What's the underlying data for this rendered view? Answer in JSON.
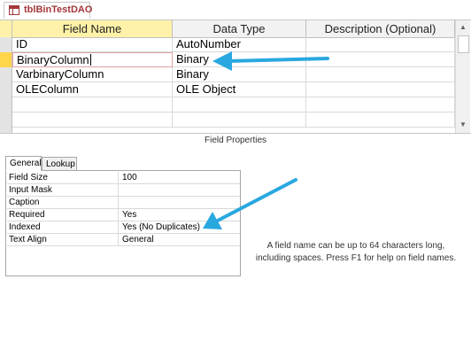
{
  "tab": {
    "title": "tblBinTestDAO",
    "icon": "table-icon"
  },
  "grid": {
    "columns": [
      "Field Name",
      "Data Type",
      "Description (Optional)"
    ],
    "rows": [
      {
        "name": "ID",
        "type": "AutoNumber",
        "description": ""
      },
      {
        "name": "BinaryColumn",
        "type": "Binary",
        "description": ""
      },
      {
        "name": "VarbinaryColumn",
        "type": "Binary",
        "description": ""
      },
      {
        "name": "OLEColumn",
        "type": "OLE Object",
        "description": ""
      }
    ],
    "selected_row": 1
  },
  "field_properties_label": "Field Properties",
  "property_tabs": [
    "General",
    "Lookup"
  ],
  "properties": [
    {
      "name": "Field Size",
      "value": "100"
    },
    {
      "name": "Input Mask",
      "value": ""
    },
    {
      "name": "Caption",
      "value": ""
    },
    {
      "name": "Required",
      "value": "Yes"
    },
    {
      "name": "Indexed",
      "value": "Yes (No Duplicates)"
    },
    {
      "name": "Text Align",
      "value": "General"
    }
  ],
  "help_text": "A field name can be up to 64 characters long, including spaces. Press F1 for help on field names.",
  "colors": {
    "accent": "#a4373a",
    "selected_row": "#ffd54a",
    "annotation_arrow": "#29a8e0"
  }
}
